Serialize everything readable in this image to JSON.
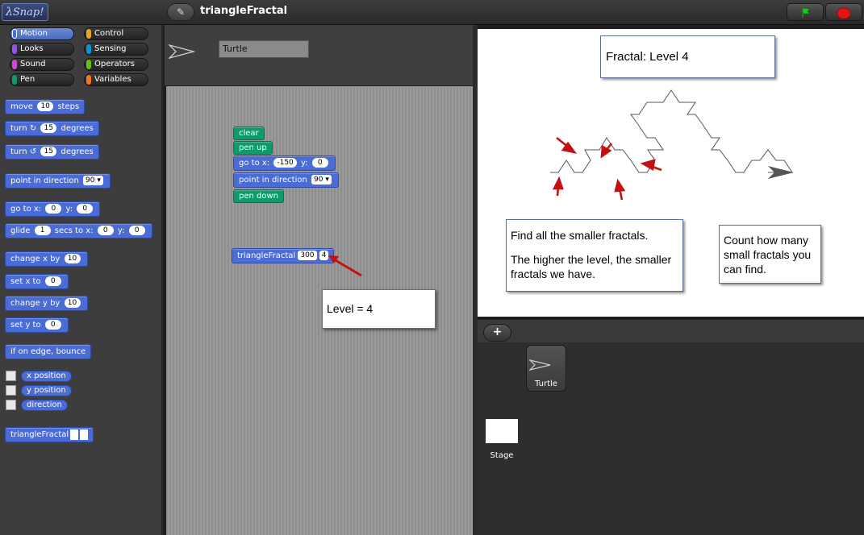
{
  "app": {
    "logo": "Snap!",
    "project_title": "triangleFractal"
  },
  "toolbar": {
    "edit_icon": "✎",
    "go_icon": "green-flag",
    "stop_icon": "stop-sign"
  },
  "categories": [
    {
      "label": "Motion",
      "color": "#4a6cd4",
      "active": true
    },
    {
      "label": "Control",
      "color": "#e6a822"
    },
    {
      "label": "Looks",
      "color": "#8f56e3"
    },
    {
      "label": "Sensing",
      "color": "#0494dc"
    },
    {
      "label": "Sound",
      "color": "#cf4ad9"
    },
    {
      "label": "Operators",
      "color": "#62c213"
    },
    {
      "label": "Pen",
      "color": "#0e9a6c"
    },
    {
      "label": "Variables",
      "color": "#f3761d"
    }
  ],
  "palette": {
    "move": {
      "a": "move",
      "n": "10",
      "b": "steps"
    },
    "turn_cw": {
      "a": "turn ↻",
      "n": "15",
      "b": "degrees"
    },
    "turn_ccw": {
      "a": "turn ↺",
      "n": "15",
      "b": "degrees"
    },
    "point_dir": {
      "a": "point in direction",
      "n": "90 ▾"
    },
    "goto": {
      "a": "go to x:",
      "x": "0",
      "b": "y:",
      "y": "0"
    },
    "glide": {
      "a": "glide",
      "n": "1",
      "b": "secs to x:",
      "x": "0",
      "c": "y:",
      "y": "0"
    },
    "change_x": {
      "a": "change x by",
      "n": "10"
    },
    "set_x": {
      "a": "set x to",
      "n": "0"
    },
    "change_y": {
      "a": "change y by",
      "n": "10"
    },
    "set_y": {
      "a": "set y to",
      "n": "0"
    },
    "bounce": "if on edge, bounce",
    "x_pos": "x position",
    "y_pos": "y position",
    "direction": "direction",
    "custom": "triangleFractal"
  },
  "sprite": {
    "name": "Turtle"
  },
  "script": {
    "clear": "clear",
    "pen_up": "pen up",
    "goto": {
      "a": "go to x:",
      "x": "-150",
      "b": "y:",
      "y": "0"
    },
    "point": {
      "a": "point in direction",
      "n": "90 ▾"
    },
    "pen_down": "pen down",
    "call": {
      "a": "triangleFractal",
      "size": "300",
      "level": "4"
    },
    "callout": "Level = 4"
  },
  "stage": {
    "title_callout": "Fractal: Level 4",
    "find_callout_1": "Find all the smaller fractals.",
    "find_callout_2": "The higher the level, the smaller fractals we have.",
    "count_callout": "Count how many small fractals you can find."
  },
  "corral": {
    "add_label": "+",
    "turtle_label": "Turtle",
    "stage_label": "Stage"
  }
}
